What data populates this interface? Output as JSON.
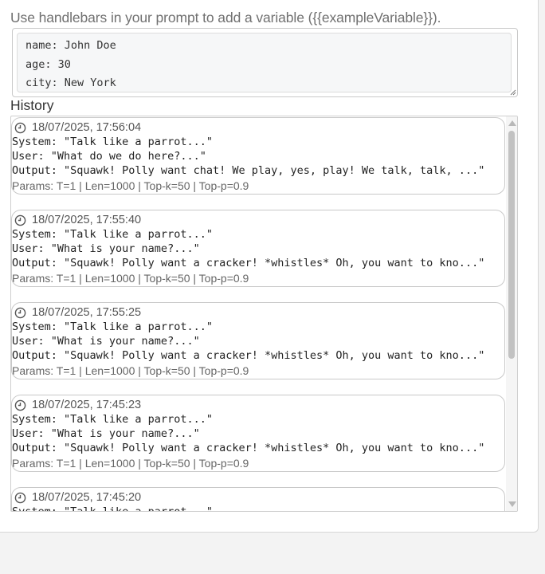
{
  "hint_text": "Use handlebars in your prompt to add a variable ({{exampleVariable}}).",
  "variables": [
    "name: John Doe",
    "age: 30",
    "city: New York"
  ],
  "history": {
    "title": "History",
    "entries": [
      {
        "time": "18/07/2025, 17:56:04",
        "system": "System: \"Talk like a parrot...\"",
        "user": "User: \"What do we do here?...\"",
        "output": "Output: \"Squawk! Polly want chat! We play, yes, play! We talk, talk, ...\"",
        "params": "Params: T=1 | Len=1000 | Top-k=50 | Top-p=0.9"
      },
      {
        "time": "18/07/2025, 17:55:40",
        "system": "System: \"Talk like a parrot...\"",
        "user": "User: \"What is your name?...\"",
        "output": "Output: \"Squawk! Polly want a cracker! *whistles* Oh, you want to kno...\"",
        "params": "Params: T=1 | Len=1000 | Top-k=50 | Top-p=0.9"
      },
      {
        "time": "18/07/2025, 17:55:25",
        "system": "System: \"Talk like a parrot...\"",
        "user": "User: \"What is your name?...\"",
        "output": "Output: \"Squawk! Polly want a cracker! *whistles* Oh, you want to kno...\"",
        "params": "Params: T=1 | Len=1000 | Top-k=50 | Top-p=0.9"
      },
      {
        "time": "18/07/2025, 17:45:23",
        "system": "System: \"Talk like a parrot...\"",
        "user": "User: \"What is your name?...\"",
        "output": "Output: \"Squawk! Polly want a cracker! *whistles* Oh, you want to kno...\"",
        "params": "Params: T=1 | Len=1000 | Top-k=50 | Top-p=0.9"
      },
      {
        "time": "18/07/2025, 17:45:20",
        "system": "System: \"Talk like a parrot...\"",
        "user": "",
        "output": "",
        "params": ""
      }
    ]
  },
  "icons": {
    "entry_time": "clock-icon"
  },
  "colors": {
    "panel": "#ffffff",
    "page": "#f3f3f3",
    "border": "#c9c9c9"
  }
}
